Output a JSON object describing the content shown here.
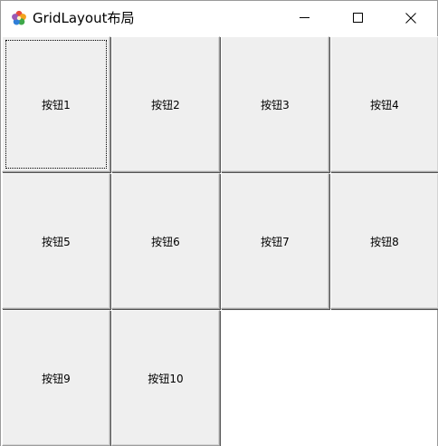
{
  "window": {
    "title": "GridLayout布局",
    "icon": "flower-app-icon"
  },
  "controls": {
    "minimize_icon": "minimize-icon",
    "maximize_icon": "maximize-icon",
    "close_icon": "close-icon"
  },
  "buttons": [
    {
      "label": "按钮1",
      "focused": true
    },
    {
      "label": "按钮2"
    },
    {
      "label": "按钮3"
    },
    {
      "label": "按钮4"
    },
    {
      "label": "按钮5"
    },
    {
      "label": "按钮6"
    },
    {
      "label": "按钮7"
    },
    {
      "label": "按钮8"
    },
    {
      "label": "按钮9"
    },
    {
      "label": "按钮10"
    }
  ],
  "colors": {
    "button_face": "#efefef",
    "window_background": "#ffffff",
    "border": "#9a9a9a"
  }
}
